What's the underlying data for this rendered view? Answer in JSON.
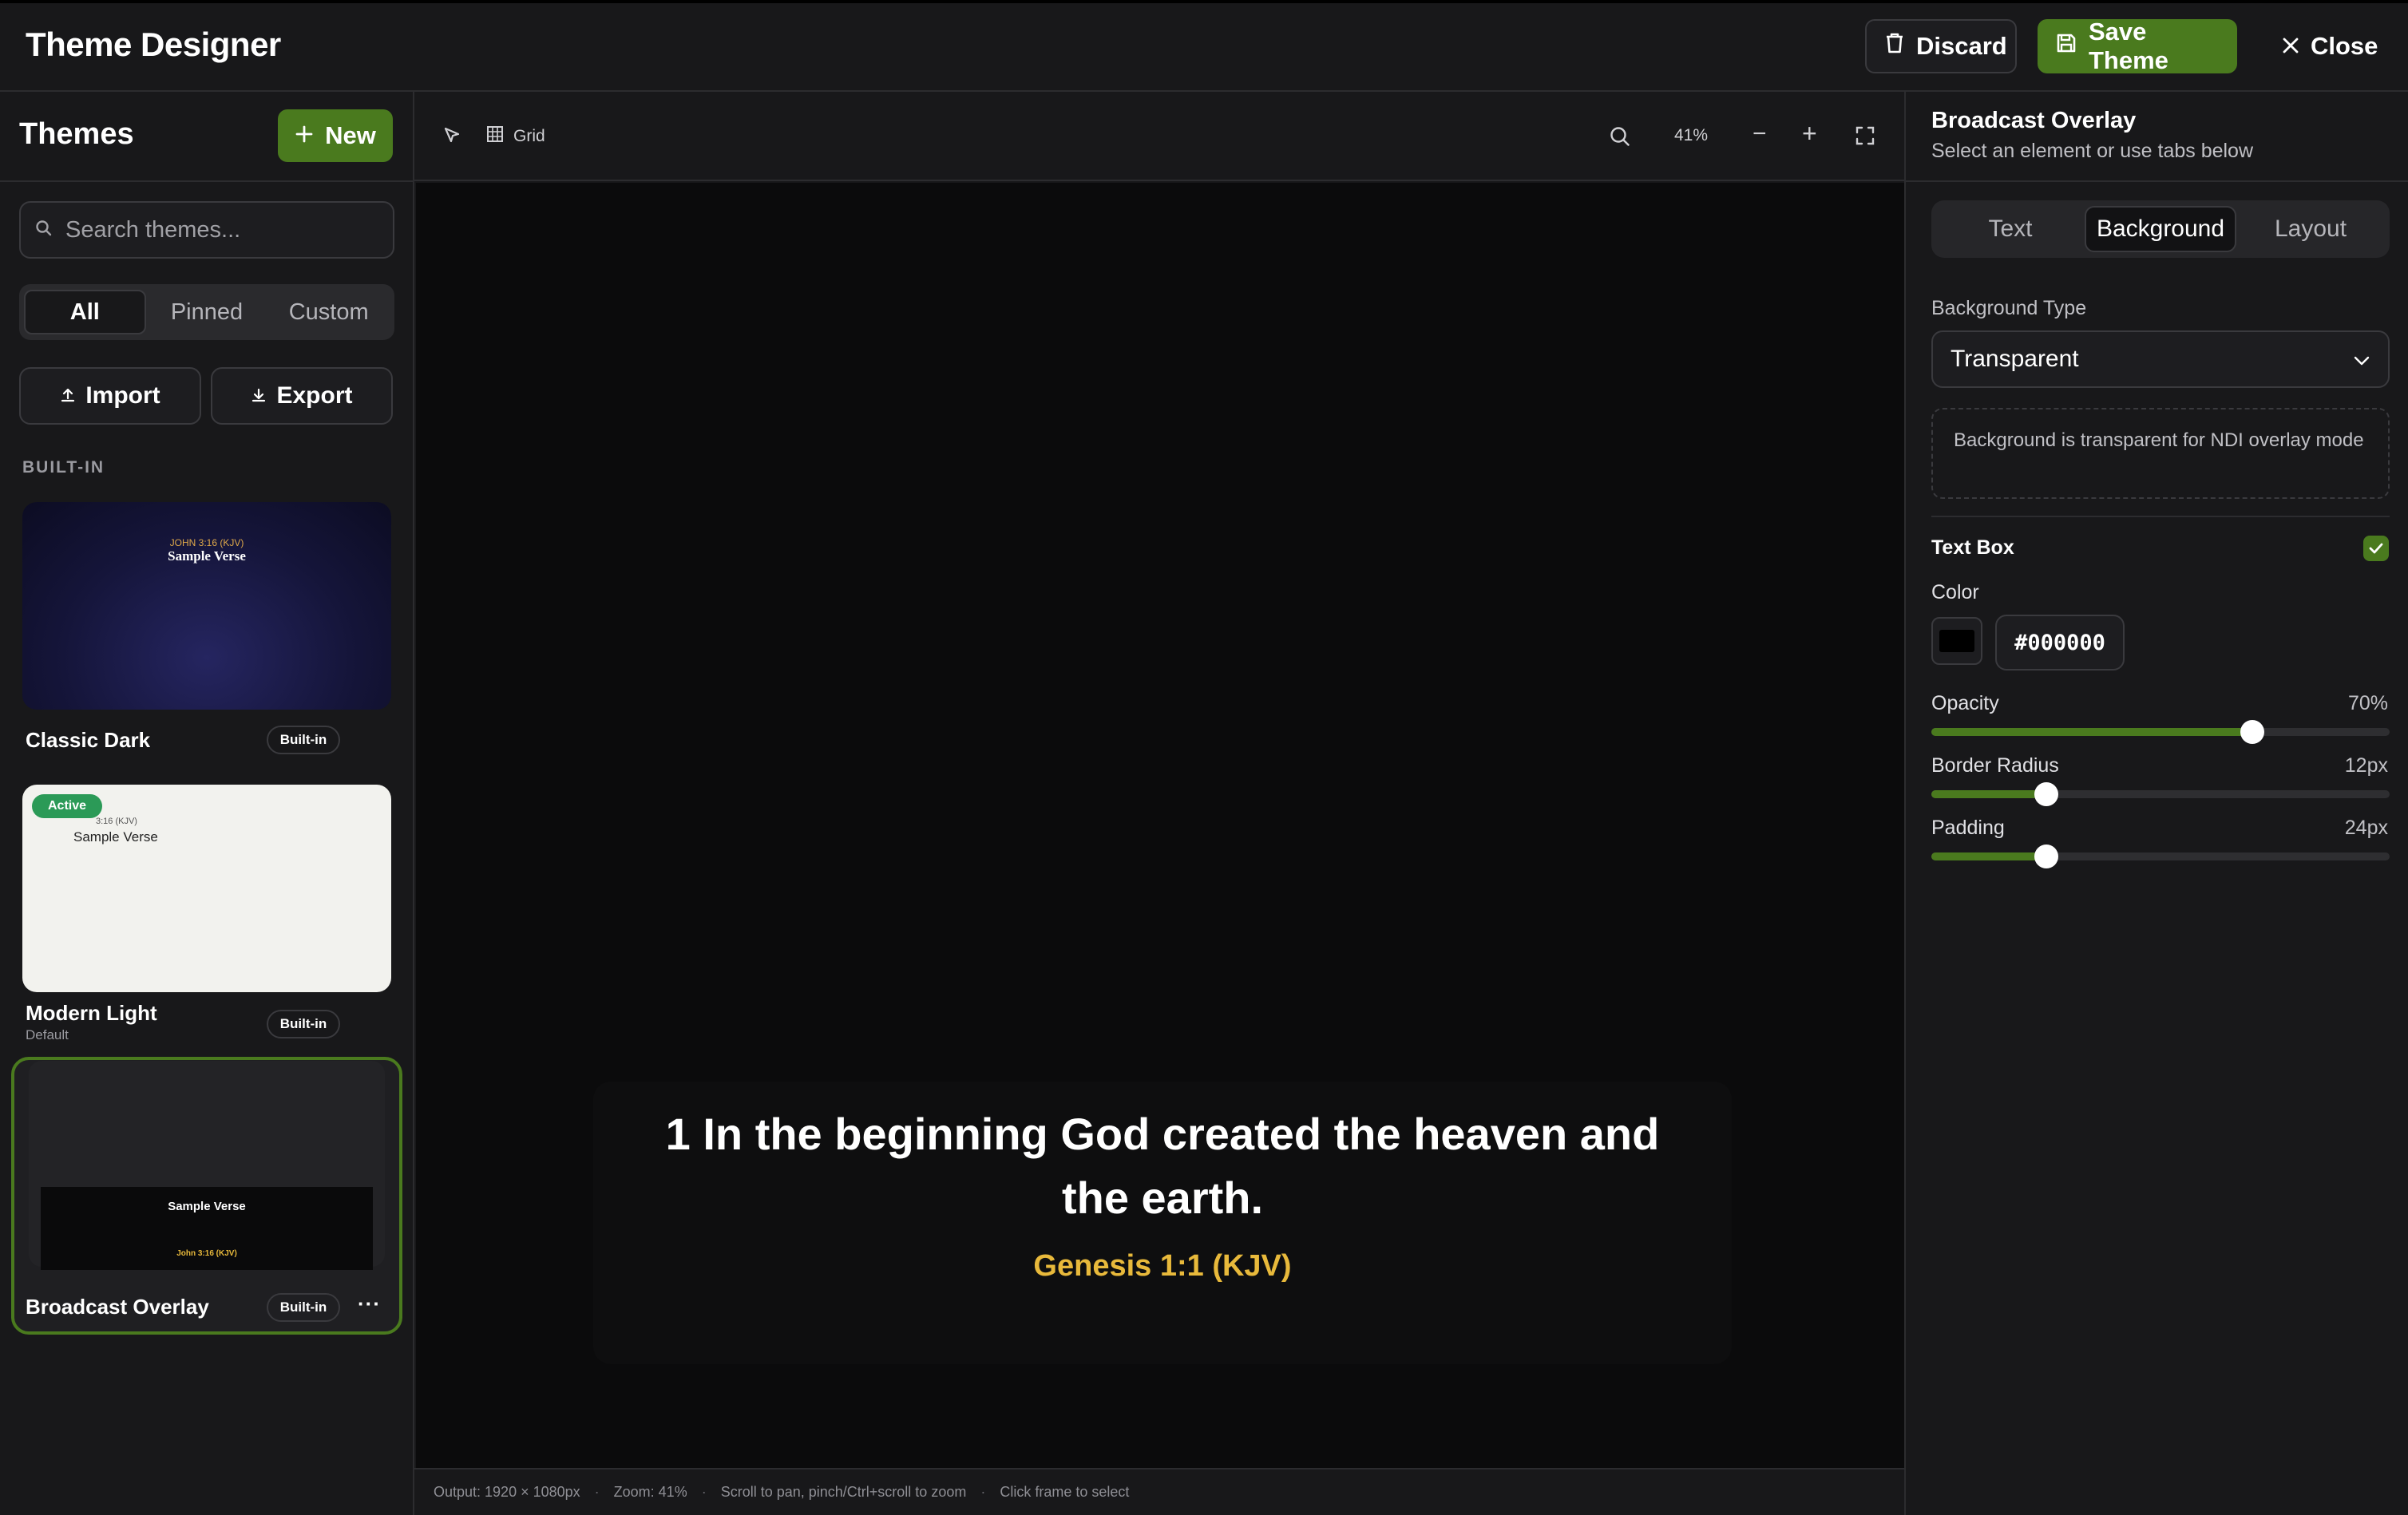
{
  "header": {
    "title": "Theme Designer",
    "discard_label": "Discard",
    "save_label": "Save Theme",
    "close_label": "Close"
  },
  "sidebar": {
    "title": "Themes",
    "new_label": "New",
    "search_placeholder": "Search themes...",
    "filters": [
      "All",
      "Pinned",
      "Custom"
    ],
    "active_filter": "All",
    "import_label": "Import",
    "export_label": "Export",
    "section_label": "BUILT-IN",
    "themes": [
      {
        "name": "Classic Dark",
        "badge": "Built-in",
        "preview_ref": "JOHN 3:16 (KJV)",
        "preview_verse": "Sample Verse"
      },
      {
        "name": "Modern Light",
        "subtitle": "Default",
        "badge": "Built-in",
        "active_label": "Active",
        "preview_ref": "3:16 (KJV)",
        "preview_verse": "Sample Verse"
      },
      {
        "name": "Broadcast Overlay",
        "badge": "Built-in",
        "preview_verse": "Sample Verse",
        "preview_ref": "John 3:16 (KJV)",
        "more": "···"
      }
    ]
  },
  "canvas": {
    "grid_label": "Grid",
    "zoom": "41%",
    "minus": "−",
    "plus": "+",
    "verse_text": "1 In the beginning God created the heaven and the earth.",
    "reference": "Genesis 1:1 (KJV)",
    "status": [
      "Output: 1920 × 1080px",
      "Zoom: 41%",
      "Scroll to pan, pinch/Ctrl+scroll to zoom",
      "Click frame to select"
    ],
    "separator": "·"
  },
  "panel": {
    "title": "Broadcast Overlay",
    "subtitle": "Select an element or use tabs below",
    "tabs": [
      "Text",
      "Background",
      "Layout"
    ],
    "active_tab": "Background",
    "bg_type_label": "Background Type",
    "bg_type_value": "Transparent",
    "note": "Background is transparent for NDI overlay mode",
    "text_box_label": "Text Box",
    "text_box_enabled": true,
    "color_label": "Color",
    "color_value": "#000000",
    "sliders": [
      {
        "label": "Opacity",
        "value": "70%",
        "level": 0.7
      },
      {
        "label": "Border Radius",
        "value": "12px",
        "level": 0.25
      },
      {
        "label": "Padding",
        "value": "24px",
        "level": 0.25
      }
    ]
  },
  "colors": {
    "accent": "#4a7a1e",
    "gold": "#e8b93b",
    "active_badge": "#2b9a57"
  }
}
